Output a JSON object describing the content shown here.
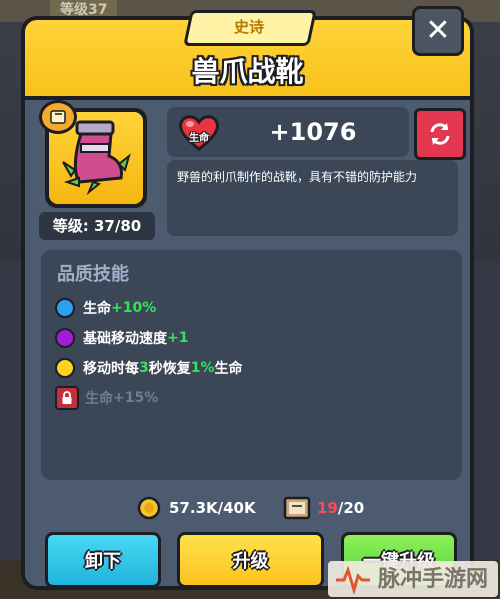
{
  "background": {
    "level_tag": "等级37"
  },
  "dialog": {
    "rarity": "史诗",
    "item_name": "兽爪战靴",
    "level_label": "等级: 37/80",
    "stat": {
      "icon_label": "生命",
      "value": "+1076"
    },
    "description": "野兽的利爪制作的战靴，具有不错的防护能力",
    "skills_title": "品质技能",
    "skills": [
      {
        "color": "#2f9ff0",
        "name": "生命",
        "bonus": "+10%",
        "locked": false
      },
      {
        "color": "#a31bd6",
        "name": "基础移动速度",
        "bonus": "+1",
        "locked": false
      },
      {
        "color": "#ffd21f",
        "prefix": "移动时每",
        "n1": "3",
        "mid": "秒恢复",
        "n2": "1%",
        "suffix": "生命",
        "locked": false
      },
      {
        "name": "生命",
        "bonus": "+15%",
        "locked": true
      }
    ],
    "coins": "57.3K/40K",
    "books": {
      "current": "19",
      "total": "/20"
    },
    "buttons": {
      "unequip": "卸下",
      "upgrade": "升级",
      "one_click": "一键升级"
    }
  },
  "watermark": "脉冲手游网",
  "colors": {
    "header": "#f8c21a",
    "panel": "#4d5b70",
    "accent_green": "#35e25a",
    "accent_red": "#e2374e"
  },
  "icons": [
    "close-icon",
    "boot-icon",
    "book-icon",
    "heart-icon",
    "swap-icon",
    "lock-icon",
    "coin-icon"
  ]
}
